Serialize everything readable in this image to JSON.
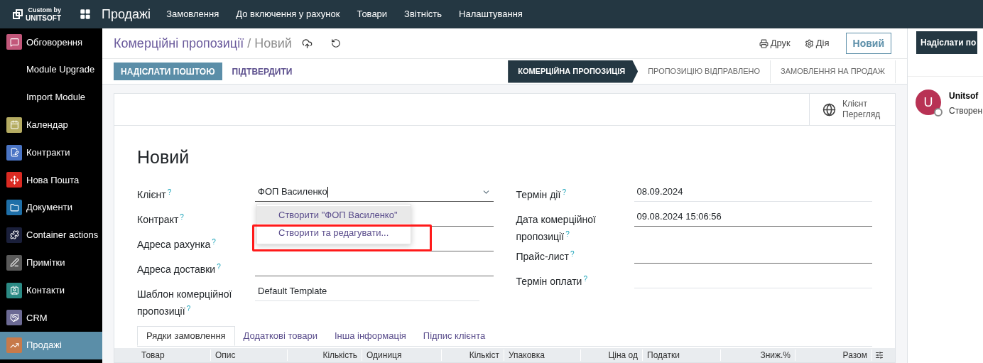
{
  "topbar": {
    "brand": {
      "line1": "Custom by",
      "line2": "UNITSOFT"
    },
    "app_title": "Продажі",
    "menu": [
      "Замовлення",
      "До включення у рахунок",
      "Товари",
      "Звітність",
      "Налаштування"
    ]
  },
  "sidebar": {
    "items": [
      {
        "name": "Обговорення",
        "selected": false,
        "color": "#c2577a"
      },
      {
        "name": "Module Upgrade",
        "selected": false
      },
      {
        "name": "Import Module",
        "selected": false
      },
      {
        "name": "Календар",
        "selected": false,
        "color": "#b5ac62"
      },
      {
        "name": "Контракти",
        "selected": false,
        "color": "#4a74c4"
      },
      {
        "name": "Нова Пошта",
        "selected": false,
        "color": "#da2a22"
      },
      {
        "name": "Документи",
        "selected": false,
        "color": "#1e6fa8"
      },
      {
        "name": "Container actions",
        "selected": false,
        "color": "#1a1f3a"
      },
      {
        "name": "Примітки",
        "selected": false,
        "color": "#5a5a5a"
      },
      {
        "name": "Контакти",
        "selected": false,
        "color": "#2b8a84"
      },
      {
        "name": "CRM",
        "selected": false,
        "color": "#6c6a94"
      },
      {
        "name": "Продажі",
        "selected": true,
        "color": "#c77a4a"
      }
    ]
  },
  "control_panel": {
    "breadcrumb": {
      "parent": "Комерційні пропозиції",
      "separator": "/",
      "current": "Новий"
    },
    "print": "Друк",
    "action": "Дія",
    "new_button": "Новий",
    "buttons": [
      {
        "label": "НАДІСЛАТИ ПОШТОЮ",
        "primary": true
      },
      {
        "label": "ПІДТВЕРДИТИ",
        "primary": false
      }
    ],
    "status_steps": [
      {
        "label": "КОМЕРЦІЙНА ПРОПОЗИЦІЯ",
        "selected": true
      },
      {
        "label": "ПРОПОЗИЦІЮ ВІДПРАВЛЕНО",
        "selected": false
      },
      {
        "label": "ЗАМОВЛЕННЯ НА ПРОДАЖ",
        "selected": false
      }
    ]
  },
  "sheet": {
    "smart_button": {
      "line1": "Клієнт",
      "line2": "Перегляд"
    },
    "title": "Новий",
    "left_fields": [
      {
        "label": "Клієнт",
        "help": "?",
        "value": "ФОП Василенко",
        "kind": "many2one",
        "focused": true
      },
      {
        "label": "Контракт",
        "help": "?",
        "kind": "many2one",
        "focused": false
      },
      {
        "label": "Адреса рахунка",
        "help": "?",
        "kind": "many2one",
        "focused": false
      },
      {
        "label": "Адреса доставки",
        "help": "?",
        "kind": "many2one",
        "focused": false
      },
      {
        "label": "Шаблон комерційної пропозиції",
        "help": "?",
        "value": "Default Template",
        "kind": "text",
        "focused": false
      }
    ],
    "right_fields": [
      {
        "label": "Термін дії",
        "help": "?",
        "value": "08.09.2024",
        "kind": "text",
        "focused": false
      },
      {
        "label": "Дата комерційної пропозиції",
        "help": "?",
        "value": "09.08.2024 15:06:56",
        "kind": "many2one",
        "focused": false
      },
      {
        "label": "Прайс-лист",
        "help": "?",
        "kind": "many2one",
        "focused": false
      },
      {
        "label": "Термін оплати",
        "help": "?",
        "kind": "text",
        "focused": false
      }
    ],
    "dropdown": {
      "options": [
        {
          "label": "Створити \"ФОП Василенко\"",
          "selected": true
        },
        {
          "label": "Створити та редагувати...",
          "selected": false
        }
      ],
      "highlighted": true
    },
    "tabs": [
      {
        "label": "Рядки замовлення",
        "selected": true
      },
      {
        "label": "Додаткові товари",
        "selected": false
      },
      {
        "label": "Інша інформація",
        "selected": false
      },
      {
        "label": "Підпис клієнта",
        "selected": false
      }
    ],
    "table": {
      "columns": [
        "Товар",
        "Опис",
        "Кількість",
        "Одиниця",
        "Кількіст",
        "Упаковка",
        "Ціна од",
        "Податки",
        "Зниж.%",
        "Разом"
      ]
    }
  },
  "chatter": {
    "send_button": "Надіслати по",
    "message": {
      "avatar_letter": "U",
      "author": "Unitsof",
      "text": "Створен"
    }
  }
}
